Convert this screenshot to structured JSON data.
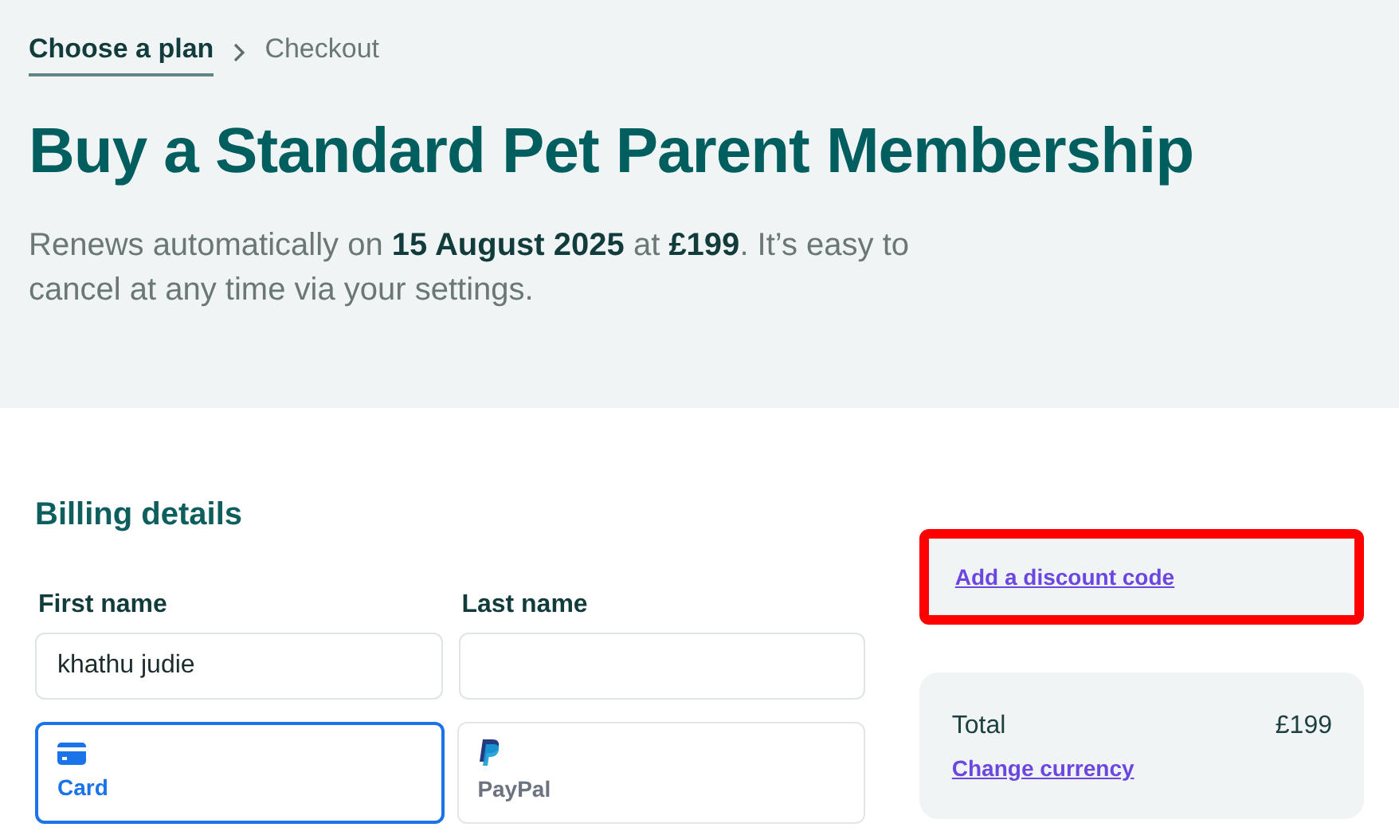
{
  "breadcrumb": [
    {
      "label": "Choose a plan",
      "selected": true
    },
    {
      "label": "Checkout",
      "selected": false
    }
  ],
  "title": "Buy a Standard Pet Parent Membership",
  "subtitle": "Renews automatically on **15 August 2025** at **£199**. It’s easy to cancel at any time via your settings.",
  "billing": {
    "heading": "Billing details",
    "fields": [
      {
        "label": "First name",
        "value": "khathu judie"
      },
      {
        "label": "Last name"
      }
    ]
  },
  "payment_methods": [
    {
      "kind": "card",
      "label": "Card",
      "selected": true
    },
    {
      "kind": "paypal",
      "label": "PayPal",
      "selected": false
    }
  ],
  "discount": {
    "link": "Add a discount code",
    "highlighted": true
  },
  "summary": {
    "label": "Total",
    "amount": "£199",
    "link": "Change currency"
  }
}
